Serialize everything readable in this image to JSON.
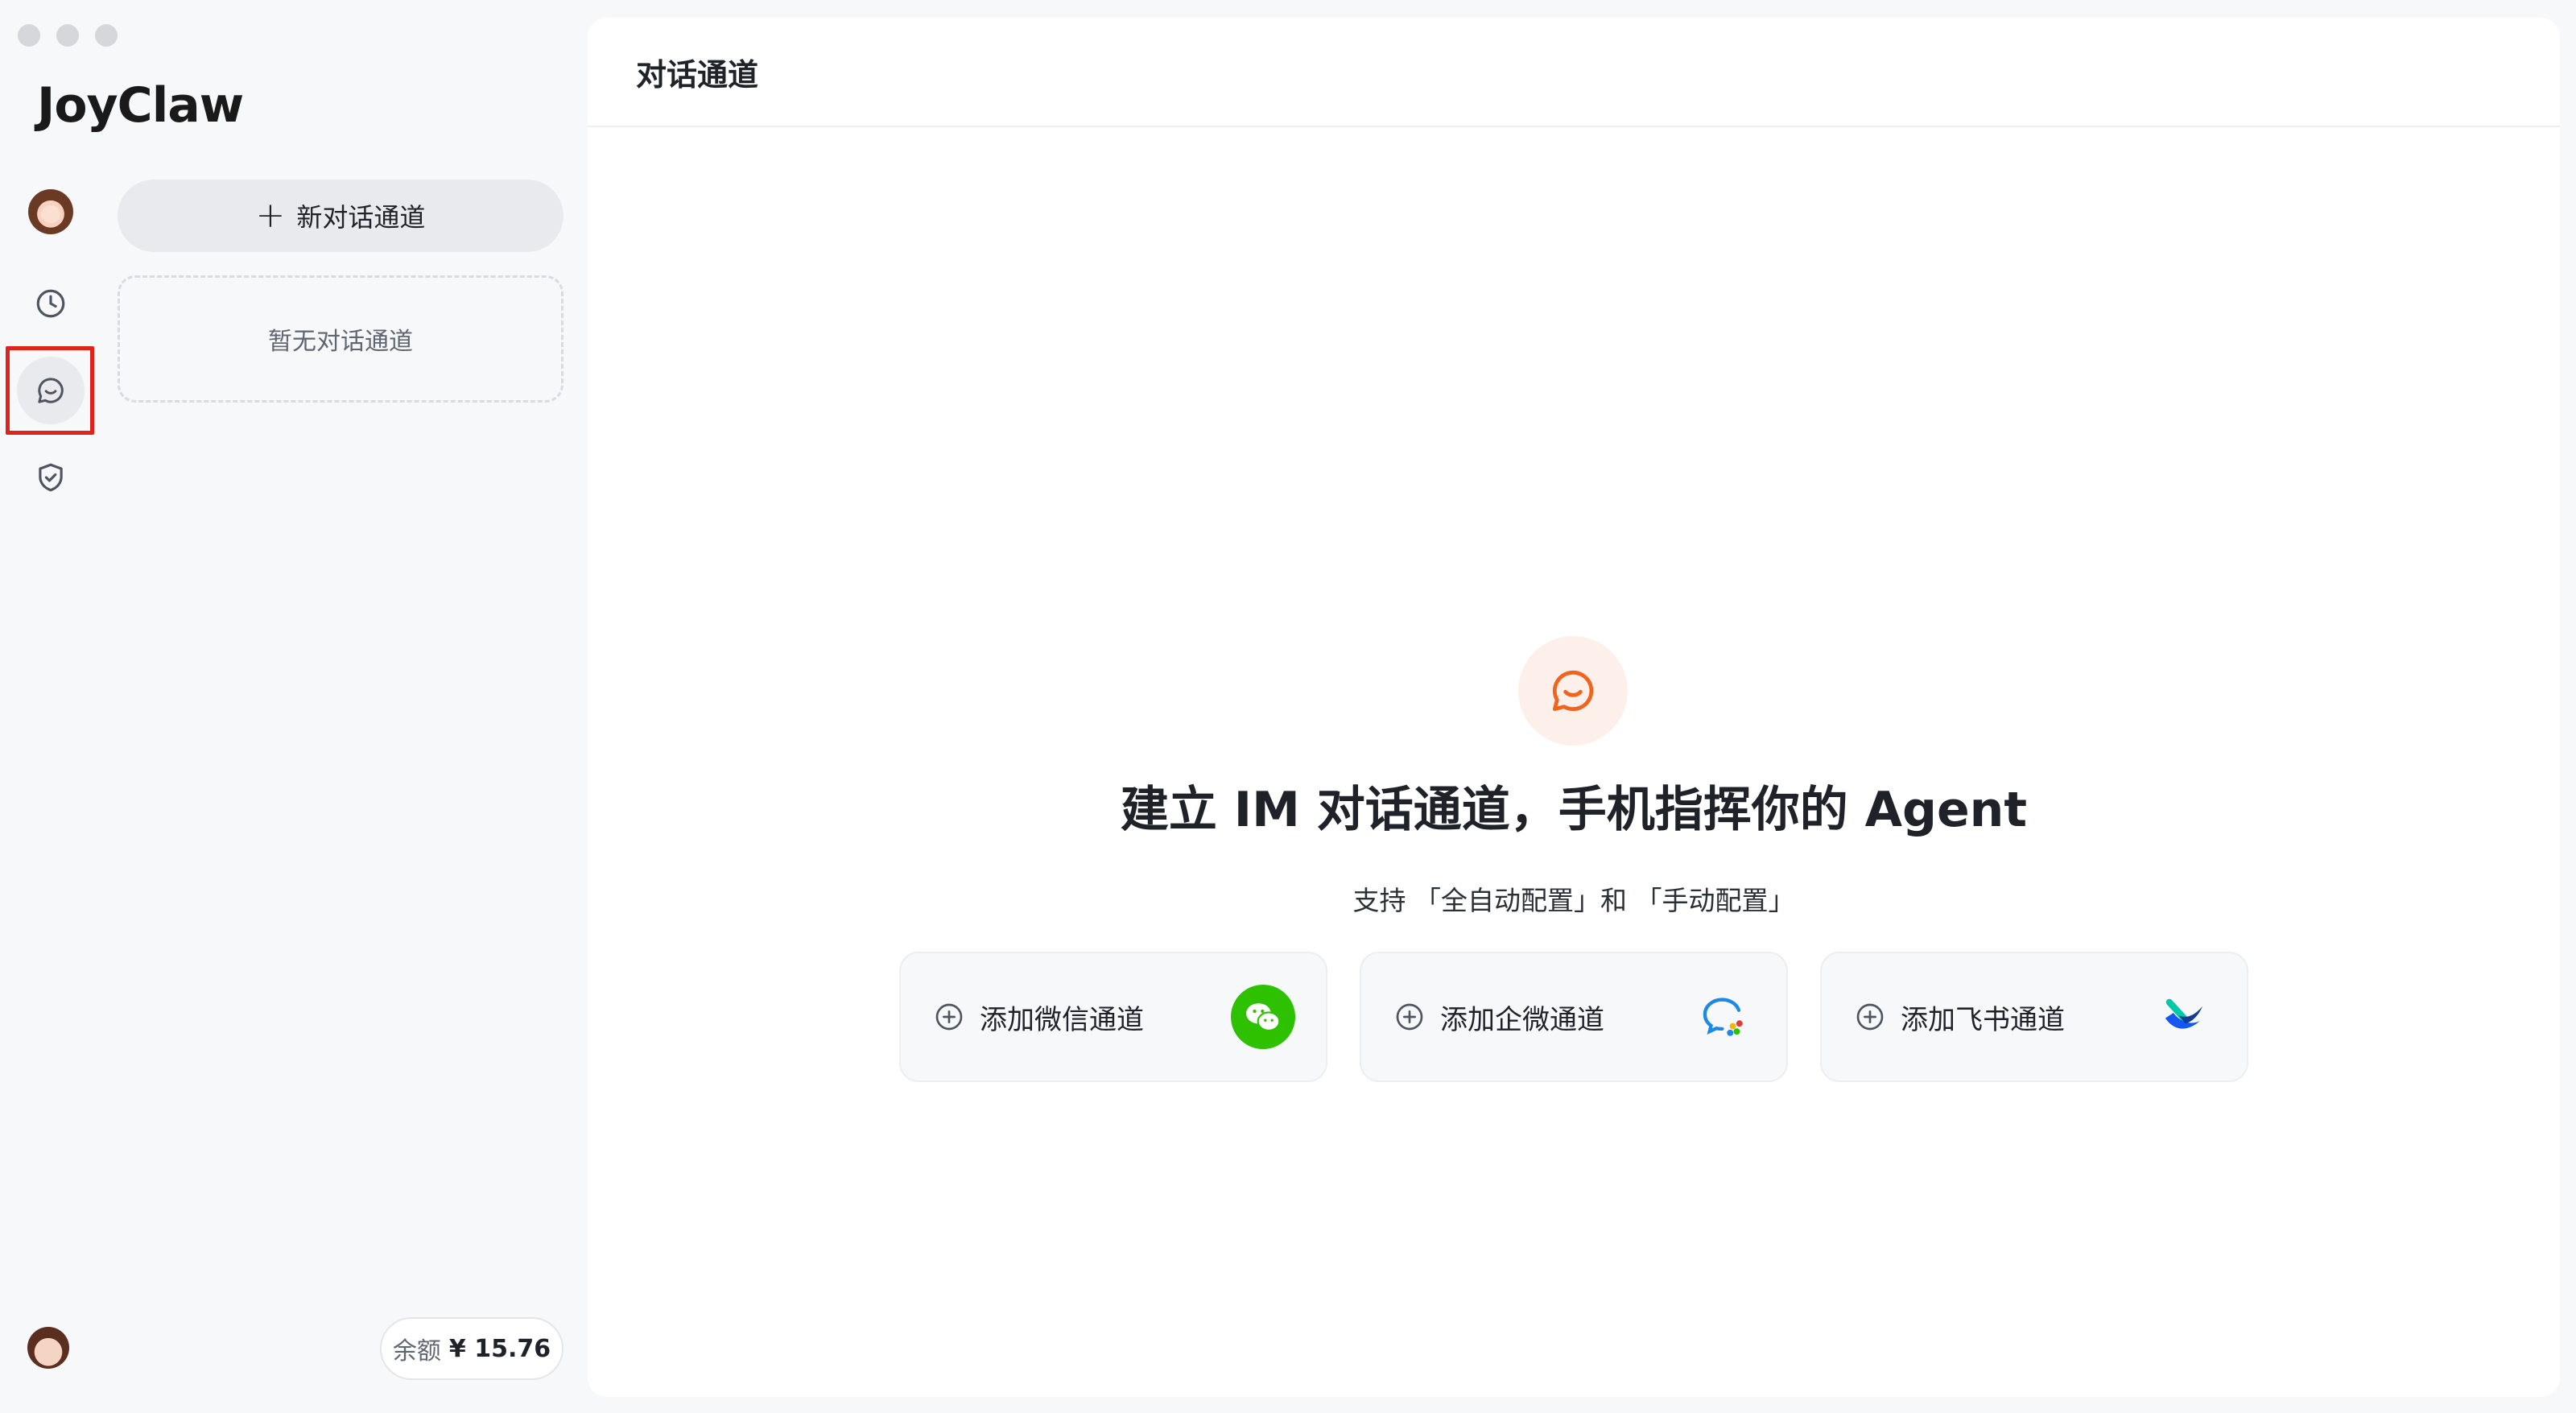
{
  "app": {
    "logo": "JoyClaw"
  },
  "sidebar": {
    "new_channel_label": "新对话通道",
    "empty_text": "暂无对话通道",
    "balance_label": "余额",
    "balance_value": "¥ 15.76"
  },
  "main": {
    "title": "对话通道",
    "headline": "建立 IM 对话通道，手机指挥你的 Agent",
    "subline": "支持 「全自动配置」和 「手动配置」",
    "cards": [
      {
        "label": "添加微信通道",
        "icon": "wechat-icon"
      },
      {
        "label": "添加企微通道",
        "icon": "wecom-icon"
      },
      {
        "label": "添加飞书通道",
        "icon": "feishu-icon"
      }
    ]
  },
  "colors": {
    "accent_orange": "#f0641e",
    "wechat_green": "#2dc100",
    "highlight_red": "#e0221c"
  },
  "rail_icons": [
    "agent-avatar-icon",
    "history-clock-icon",
    "chat-channel-icon",
    "shield-check-icon"
  ]
}
